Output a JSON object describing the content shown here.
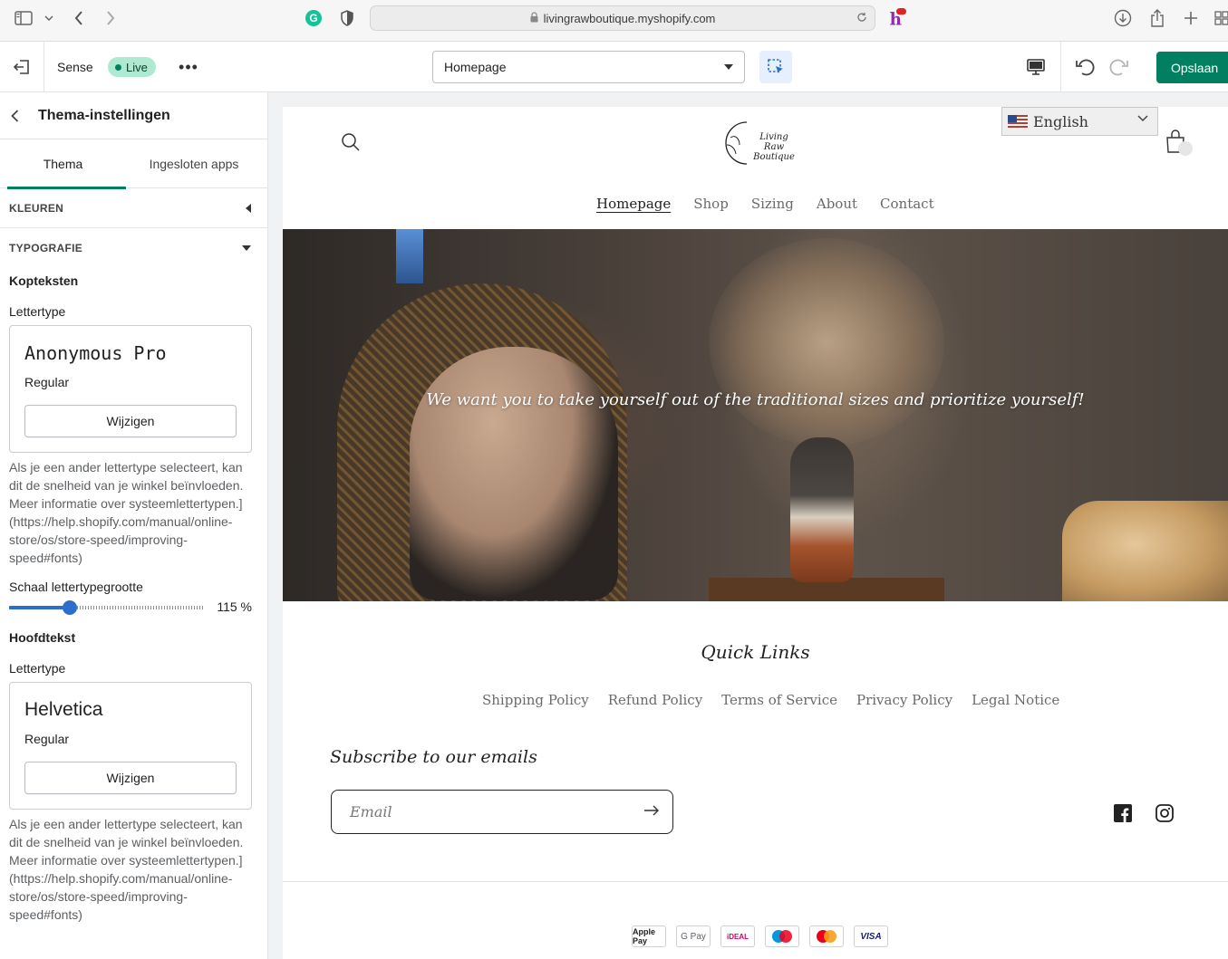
{
  "browser": {
    "url": "livingrawboutique.myshopify.com"
  },
  "topbar": {
    "theme_name": "Sense",
    "live_label": "Live",
    "page_selector": "Homepage",
    "save_label": "Opslaan"
  },
  "sidebar": {
    "title": "Thema-instellingen",
    "tabs": [
      "Thema",
      "Ingesloten apps"
    ],
    "section_colors": "KLEUREN",
    "section_typography": "TYPOGRAFIE",
    "headings": {
      "title": "Kopteksten",
      "font_label": "Lettertype",
      "font_name": "Anonymous Pro",
      "font_style": "Regular",
      "change_label": "Wijzigen",
      "help": "Als je een ander lettertype selecteert, kan dit de snelheid van je winkel beïnvloeden. Meer informatie over systeemlettertypen.](https://help.shopify.com/manual/online-store/os/store-speed/improving-speed#fonts)"
    },
    "scale": {
      "label": "Schaal lettertypegrootte",
      "value": "115 %",
      "fraction": 0.31
    },
    "body": {
      "title": "Hoofdtekst",
      "font_label": "Lettertype",
      "font_name": "Helvetica",
      "font_style": "Regular",
      "change_label": "Wijzigen",
      "help": "Als je een ander lettertype selecteert, kan dit de snelheid van je winkel beïnvloeden. Meer informatie over systeemlettertypen.](https://help.shopify.com/manual/online-store/os/store-speed/improving-speed#fonts)"
    }
  },
  "store": {
    "logo_line1": "Living Raw",
    "logo_line2": "Boutique",
    "language": "English",
    "nav": [
      "Homepage",
      "Shop",
      "Sizing",
      "About",
      "Contact"
    ],
    "hero_text": "We want you to take yourself out of the traditional sizes and prioritize yourself!",
    "quick_links_title": "Quick Links",
    "footer_links": [
      "Shipping Policy",
      "Refund Policy",
      "Terms of Service",
      "Privacy Policy",
      "Legal Notice"
    ],
    "subscribe_title": "Subscribe to our emails",
    "email_placeholder": "Email",
    "payments": [
      "Apple Pay",
      "G Pay",
      "iDEAL",
      "Maestro",
      "Mastercard",
      "VISA"
    ]
  },
  "colors": {
    "accent": "#008060",
    "live_badge": "#aee9d1",
    "slider": "#2c6ecb"
  }
}
